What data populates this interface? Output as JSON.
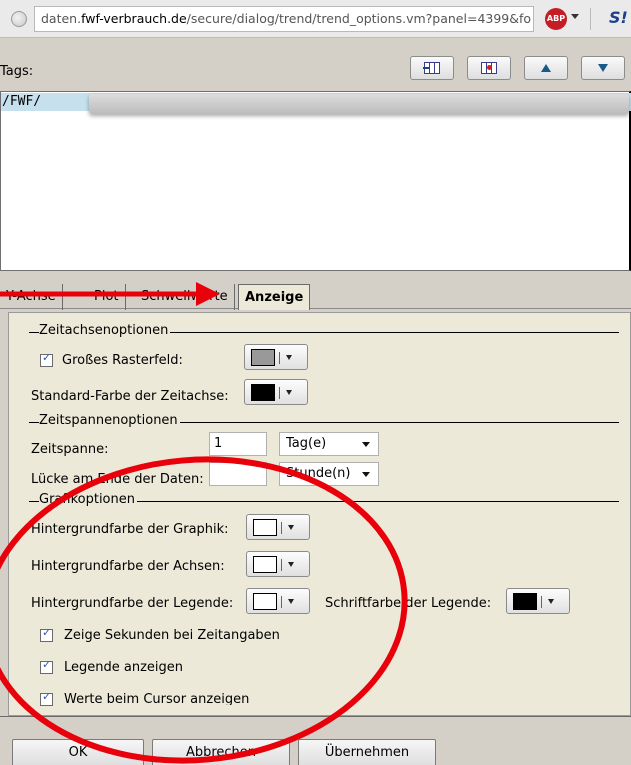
{
  "browser": {
    "url_prefix": "daten.",
    "url_domain": "fwf-verbrauch.de",
    "url_path": "/secure/dialog/trend/trend_options.vm?panel=4399&fo",
    "adblock_label": "ABP",
    "extension_label": "S!"
  },
  "tags": {
    "label": "Tags:",
    "value": "/FWF/"
  },
  "tabs": [
    {
      "label": "Y-Achse"
    },
    {
      "label": "Plot"
    },
    {
      "label": "Schwellwerte"
    },
    {
      "label": "Anzeige"
    }
  ],
  "timeaxis": {
    "group": "Zeitachsenoptionen",
    "large_grid_label": "Großes Rasterfeld:",
    "large_grid_color": "#999999",
    "default_color_label": "Standard-Farbe der Zeitachse:",
    "default_color": "#000000"
  },
  "timespan": {
    "group": "Zeitspannenoptionen",
    "span_label": "Zeitspanne:",
    "span_value": "1",
    "span_unit": "Tag(e)",
    "gap_label": "Lücke am Ende der Daten:",
    "gap_value": "",
    "gap_unit": "Stunde(n)"
  },
  "graphic": {
    "group": "Grafikoptionen",
    "bg_graphic_label": "Hintergrundfarbe der Graphik:",
    "bg_graphic_color": "#ffffff",
    "bg_axes_label": "Hintergrundfarbe der Achsen:",
    "bg_axes_color": "#ffffff",
    "bg_legend_label": "Hintergrundfarbe der Legende:",
    "bg_legend_color": "#ffffff",
    "font_legend_label": "Schriftfarbe der Legende:",
    "font_legend_color": "#000000",
    "show_seconds_label": "Zeige Sekunden bei Zeitangaben",
    "show_legend_label": "Legende anzeigen",
    "show_cursor_label": "Werte beim Cursor anzeigen"
  },
  "buttons": {
    "ok": "OK",
    "cancel": "Abbrechen",
    "apply": "Übernehmen"
  },
  "annotation": {
    "color": "#e8000b"
  }
}
